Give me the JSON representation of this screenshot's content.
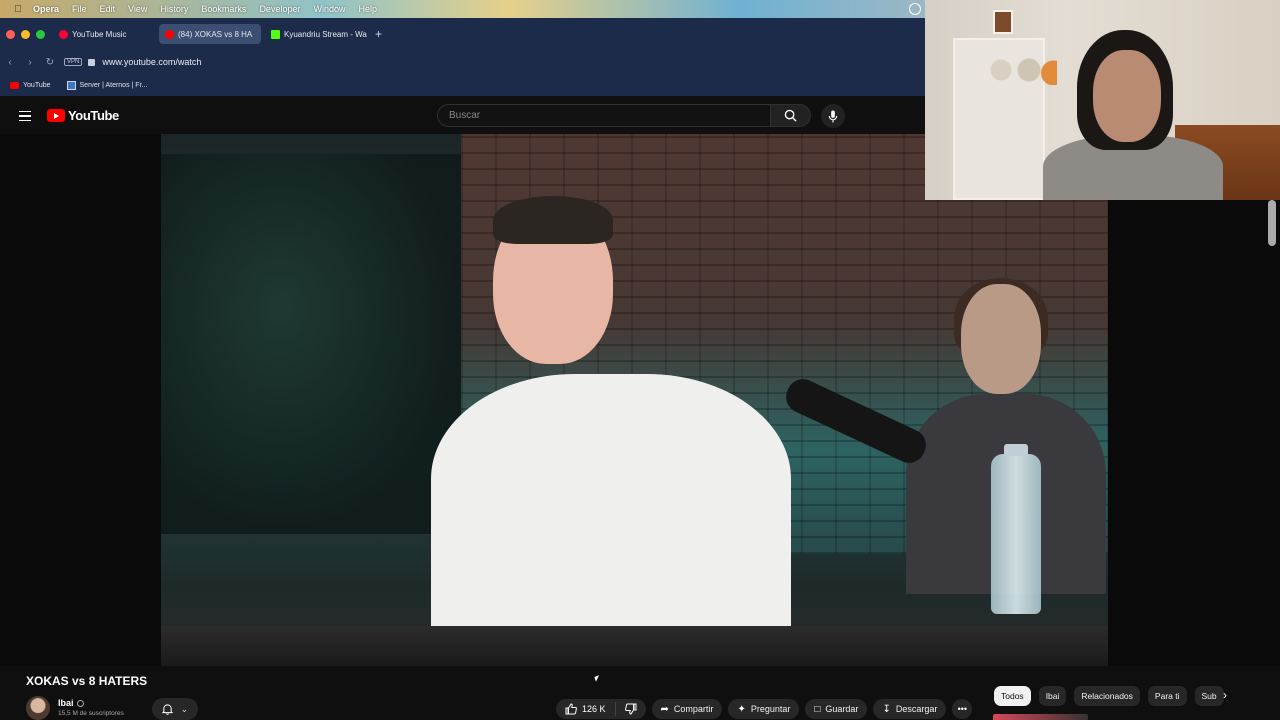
{
  "menubar": {
    "items": [
      "Opera",
      "File",
      "Edit",
      "View",
      "History",
      "Bookmarks",
      "Developer",
      "Window",
      "Help"
    ]
  },
  "tabs": [
    {
      "label": "YouTube Music",
      "favicon": "youtube-music-icon",
      "active": false
    },
    {
      "label": "(84) XOKAS vs 8 HA",
      "favicon": "youtube-icon",
      "active": true
    },
    {
      "label": "Kyuandriu Stream - Wat",
      "favicon": "kick-icon",
      "active": false
    }
  ],
  "address": {
    "url": "www.youtube.com/watch",
    "vpn": "VPN"
  },
  "bookmarks": [
    {
      "label": "YouTube",
      "icon": "youtube-icon"
    },
    {
      "label": "Server | Aternos | Fr...",
      "icon": "aternos-icon"
    }
  ],
  "youtube": {
    "logo_text": "YouTube",
    "search_placeholder": "Buscar"
  },
  "video": {
    "title": "XOKAS vs 8 HATERS",
    "channel": "Ibai",
    "subscribers": "15,5 M de suscriptores",
    "likes": "126 K",
    "actions": {
      "share": "Compartir",
      "ask": "Preguntar",
      "save": "Guardar",
      "download": "Descargar"
    }
  },
  "chips": [
    "Todos",
    "Ibai",
    "Relacionados",
    "Para ti",
    "Sub"
  ],
  "colors": {
    "brand": "#ff0000",
    "background": "#0f0f0f",
    "browser_chrome": "#1d2b4a"
  }
}
